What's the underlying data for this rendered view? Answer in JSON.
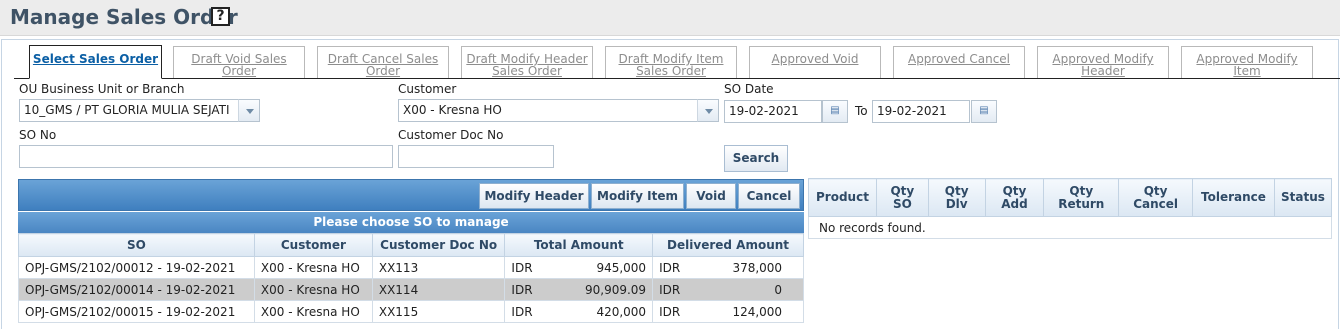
{
  "page": {
    "title": "Manage Sales Order",
    "help_label": "?"
  },
  "tabs": [
    {
      "label": "Select Sales Order",
      "active": true
    },
    {
      "label": "Draft Void Sales Order"
    },
    {
      "label": "Draft Cancel Sales Order"
    },
    {
      "label": "Draft Modify Header Sales Order"
    },
    {
      "label": "Draft Modify Item Sales Order"
    },
    {
      "label": "Approved Void"
    },
    {
      "label": "Approved Cancel"
    },
    {
      "label": "Approved Modify Header"
    },
    {
      "label": "Approved Modify Item"
    }
  ],
  "filters": {
    "ou_label": "OU Business Unit or Branch",
    "ou_value": "10_GMS / PT GLORIA MULIA SEJATI",
    "customer_label": "Customer",
    "customer_value": "X00 - Kresna HO",
    "so_date_label": "SO Date",
    "date_from": "19-02-2021",
    "to_label": "To",
    "date_to": "19-02-2021",
    "so_no_label": "SO No",
    "so_no_value": "",
    "customer_doc_label": "Customer Doc No",
    "customer_doc_value": "",
    "search_label": "Search"
  },
  "toolbar": {
    "modify_header": "Modify Header",
    "modify_item": "Modify Item",
    "void": "Void",
    "cancel": "Cancel"
  },
  "so_table": {
    "caption": "Please choose SO to manage",
    "headers": [
      "SO",
      "Customer",
      "Customer Doc No",
      "Total Amount",
      "Delivered Amount"
    ],
    "rows": [
      {
        "so": "OPJ-GMS/2102/00012 - 19-02-2021",
        "customer": "X00 - Kresna HO",
        "doc": "XX113",
        "total_cur": "IDR",
        "total": "945,000",
        "dlv_cur": "IDR",
        "dlv": "378,000",
        "selected": false
      },
      {
        "so": "OPJ-GMS/2102/00014 - 19-02-2021",
        "customer": "X00 - Kresna HO",
        "doc": "XX114",
        "total_cur": "IDR",
        "total": "90,909.09",
        "dlv_cur": "IDR",
        "dlv": "0",
        "selected": true
      },
      {
        "so": "OPJ-GMS/2102/00015 - 19-02-2021",
        "customer": "X00 - Kresna HO",
        "doc": "XX115",
        "total_cur": "IDR",
        "total": "420,000",
        "dlv_cur": "IDR",
        "dlv": "124,000",
        "selected": false
      }
    ]
  },
  "item_table": {
    "headers": [
      "Product",
      "Qty SO",
      "Qty Dlv",
      "Qty Add",
      "Qty Return",
      "Qty Cancel",
      "Tolerance",
      "Status"
    ],
    "empty_text": "No records found."
  }
}
